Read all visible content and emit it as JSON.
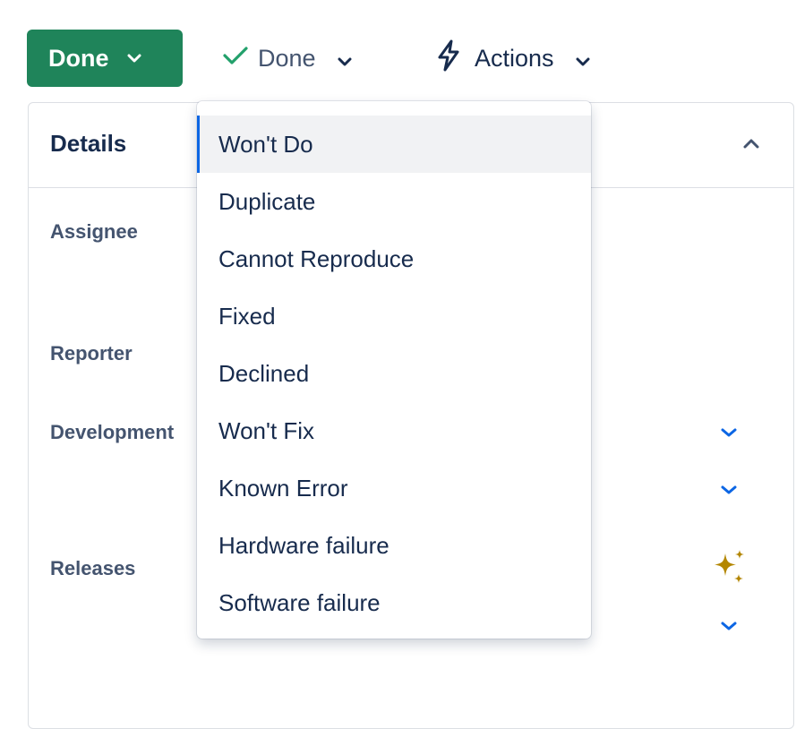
{
  "toolbar": {
    "status_label": "Done",
    "resolution_label": "Done",
    "actions_label": "Actions"
  },
  "details": {
    "title": "Details",
    "fields": [
      {
        "label": "Assignee"
      },
      {
        "label": "Reporter"
      },
      {
        "label": "Development"
      },
      {
        "label": "Releases"
      }
    ]
  },
  "dropdown": {
    "items": [
      {
        "label": "Won't Do",
        "selected": true
      },
      {
        "label": "Duplicate"
      },
      {
        "label": "Cannot Reproduce"
      },
      {
        "label": "Fixed"
      },
      {
        "label": "Declined"
      },
      {
        "label": "Won't Fix"
      },
      {
        "label": "Known Error"
      },
      {
        "label": "Hardware failure"
      },
      {
        "label": "Software failure"
      }
    ]
  },
  "colors": {
    "status_green": "#1f845a",
    "check_green": "#22a06b",
    "link_blue": "#0c66e4",
    "sparkle_gold": "#b38600",
    "text_dark": "#172b4d",
    "text_subtle": "#44546f"
  }
}
